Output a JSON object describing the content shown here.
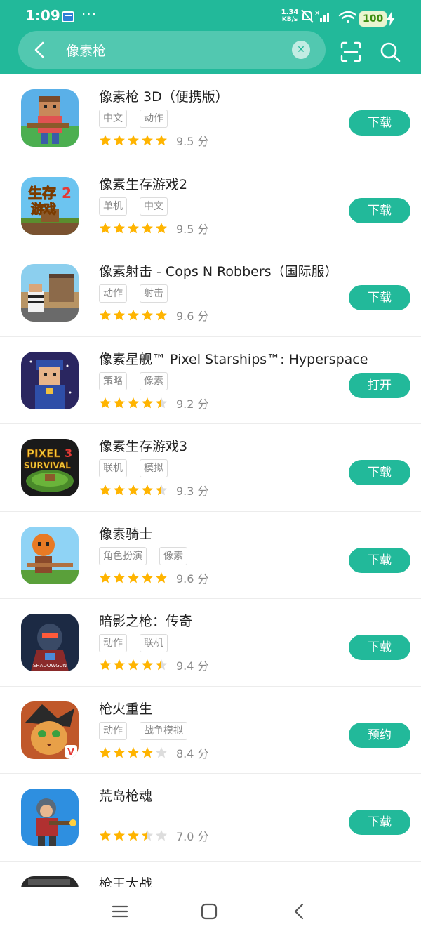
{
  "status_bar": {
    "time": "1:09",
    "dots": "···",
    "net_speed": "1.34",
    "net_unit": "KB/s",
    "battery": "100"
  },
  "search": {
    "query": "像素枪",
    "clear_icon": "close-icon",
    "back_icon": "chevron-left-icon",
    "scan_icon": "scan-icon",
    "search_icon": "search-icon"
  },
  "colors": {
    "accent": "#22b99a",
    "star": "#ffb400",
    "star_empty": "#dddddd"
  },
  "apps": [
    {
      "name": "像素枪 3D（便携版）",
      "tags": [
        "中文",
        "动作"
      ],
      "rating": 5,
      "score": "9.5 分",
      "action": "下载"
    },
    {
      "name": "像素生存游戏2",
      "tags": [
        "单机",
        "中文"
      ],
      "rating": 5,
      "score": "9.5 分",
      "action": "下载"
    },
    {
      "name": "像素射击 - Cops N Robbers（国际服）",
      "tags": [
        "动作",
        "射击"
      ],
      "rating": 5,
      "score": "9.6 分",
      "action": "下载"
    },
    {
      "name": "像素星舰™ Pixel Starships™: Hyperspace",
      "tags": [
        "策略",
        "像素"
      ],
      "rating": 4.5,
      "score": "9.2 分",
      "action": "打开"
    },
    {
      "name": "像素生存游戏3",
      "tags": [
        "联机",
        "模拟"
      ],
      "rating": 4.5,
      "score": "9.3 分",
      "action": "下载"
    },
    {
      "name": "像素骑士",
      "tags": [
        "角色扮演",
        "像素"
      ],
      "rating": 5,
      "score": "9.6 分",
      "action": "下载"
    },
    {
      "name": "暗影之枪：传奇",
      "tags": [
        "动作",
        "联机"
      ],
      "rating": 4.5,
      "score": "9.4 分",
      "action": "下载"
    },
    {
      "name": "枪火重生",
      "tags": [
        "动作",
        "战争模拟"
      ],
      "rating": 4,
      "score": "8.4 分",
      "action": "预约"
    },
    {
      "name": "荒岛枪魂",
      "tags": [],
      "rating": 3.5,
      "score": "7.0 分",
      "action": "下载"
    },
    {
      "name": "枪王大战",
      "tags": [],
      "rating": 0,
      "score": "",
      "action": ""
    }
  ],
  "nav": {
    "menu_icon": "menu-icon",
    "home_icon": "home-icon",
    "back_icon": "back-icon"
  }
}
